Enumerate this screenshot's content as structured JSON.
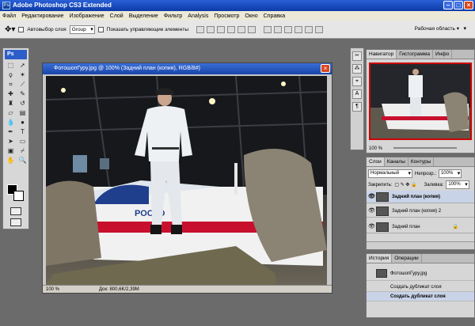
{
  "app": {
    "title": "Adobe Photoshop CS3 Extended"
  },
  "menu": [
    "Файл",
    "Редактирование",
    "Изображение",
    "Слой",
    "Выделение",
    "Фильтр",
    "Analysis",
    "Просмотр",
    "Окно",
    "Справка"
  ],
  "options": {
    "autoselect_label": "Автовыбор слоя",
    "group_value": "Group",
    "show_controls_label": "Показать управляющие элементы",
    "workspace_label": "Рабочая область ▾"
  },
  "toolbox": {
    "logo": "Ps"
  },
  "document": {
    "title": "ФотошопГуру.jpg @ 100% (Задний план (копия), RGB/8#)",
    "zoom": "100 %",
    "doc_size": "Док: 800,6K/2,39M",
    "aircraft_text": "РОСТО"
  },
  "navigator": {
    "tabs": [
      "Навигатор",
      "Гистограмма",
      "Инфо"
    ],
    "zoom": "100 %"
  },
  "layers": {
    "tabs": [
      "Слои",
      "Каналы",
      "Контуры"
    ],
    "blend_mode": "Нормальный",
    "opacity_label": "Непрозр.:",
    "opacity_value": "100%",
    "lock_label": "Закрепить:",
    "fill_label": "Заливка:",
    "fill_value": "100%",
    "items": [
      {
        "name": "Задний план (копия)"
      },
      {
        "name": "Задний план (копия) 2"
      },
      {
        "name": "Задний план"
      }
    ]
  },
  "history": {
    "tabs": [
      "История",
      "Операции"
    ],
    "snapshot": "ФотошопГуру.jpg",
    "items": [
      "Создать дубликат слоя",
      "Создать дубликат слоя"
    ]
  },
  "colors": {
    "accent": "#2b5ec9",
    "aircraft_stripe": "#c8102e"
  }
}
